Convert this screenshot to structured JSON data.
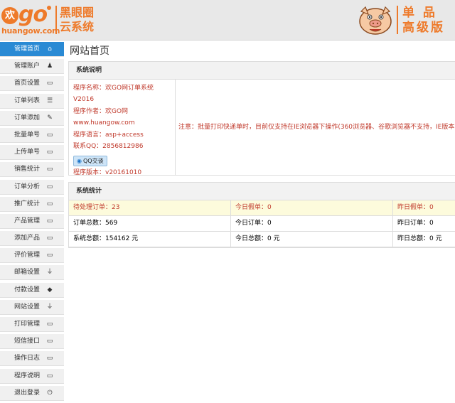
{
  "header": {
    "logo_mark": "欢",
    "logo_text": "go",
    "logo_url": "huangow.com",
    "system_name_line1": "黑眼圈",
    "system_name_line2": "云系统",
    "edition_line1": "单 品",
    "edition_line2": "高级版",
    "brand_color": "#ee7a2a"
  },
  "sidebar": {
    "items": [
      {
        "label": "管理首页",
        "icon": "home-icon",
        "glyph": "⌂",
        "active": true
      },
      {
        "label": "管理账户",
        "icon": "user-icon",
        "glyph": "♟",
        "active": false
      },
      {
        "label": "首页设置",
        "icon": "window-icon",
        "glyph": "▭",
        "active": false
      },
      {
        "label": "订单列表",
        "icon": "list-icon",
        "glyph": "☰",
        "active": false
      },
      {
        "label": "订单添加",
        "icon": "edit-icon",
        "glyph": "✎",
        "active": false
      },
      {
        "label": "批量单号",
        "icon": "window-icon",
        "glyph": "▭",
        "active": false
      },
      {
        "label": "上传单号",
        "icon": "window-icon",
        "glyph": "▭",
        "active": false
      },
      {
        "label": "销售统计",
        "icon": "window-icon",
        "glyph": "▭",
        "active": false
      },
      {
        "label": "订单分析",
        "icon": "window-icon",
        "glyph": "▭",
        "active": false
      },
      {
        "label": "推广统计",
        "icon": "window-icon",
        "glyph": "▭",
        "active": false
      },
      {
        "label": "产品管理",
        "icon": "window-icon",
        "glyph": "▭",
        "active": false
      },
      {
        "label": "添加产品",
        "icon": "window-icon",
        "glyph": "▭",
        "active": false
      },
      {
        "label": "评价管理",
        "icon": "window-icon",
        "glyph": "▭",
        "active": false
      },
      {
        "label": "邮箱设置",
        "icon": "plug-icon",
        "glyph": "⏚",
        "active": false
      },
      {
        "label": "付款设置",
        "icon": "tag-icon",
        "glyph": "◆",
        "active": false
      },
      {
        "label": "网站设置",
        "icon": "plug-icon",
        "glyph": "⏚",
        "active": false
      },
      {
        "label": "打印管理",
        "icon": "window-icon",
        "glyph": "▭",
        "active": false
      },
      {
        "label": "短信接口",
        "icon": "window-icon",
        "glyph": "▭",
        "active": false
      },
      {
        "label": "操作日志",
        "icon": "window-icon",
        "glyph": "▭",
        "active": false
      },
      {
        "label": "程序说明",
        "icon": "window-icon",
        "glyph": "▭",
        "active": false
      },
      {
        "label": "退出登录",
        "icon": "power-icon",
        "glyph": "⏻",
        "active": false
      }
    ],
    "active_color": "#2a8ad4"
  },
  "main": {
    "page_title": "网站首页",
    "system_info": {
      "heading": "系统说明",
      "lines": [
        "程序名称：欢GO网订单系统",
        "V2016",
        "程序作者：欢GO网",
        "www.huangow.com",
        "程序语言：asp+access",
        "联系QQ：2856812986"
      ],
      "qq_button": "QQ交谈",
      "version": "程序版本：v20161010",
      "note": "注意：批量打印快递单时，目前仅支持在IE浏览器下操作(360浏览器、谷歌浏览器不支持，IE版本"
    },
    "stats": {
      "heading": "系统统计",
      "rows": [
        {
          "highlight": true,
          "cells": [
            "待处理订单：23",
            "今日假单：0",
            "昨日假单：0"
          ]
        },
        {
          "highlight": false,
          "cells": [
            "订单总数：569",
            "今日订单：0",
            "昨日订单：0"
          ]
        },
        {
          "highlight": false,
          "cells": [
            "系统总额：154162 元",
            "今日总额：0 元",
            "昨日总额：0 元"
          ]
        }
      ]
    }
  }
}
